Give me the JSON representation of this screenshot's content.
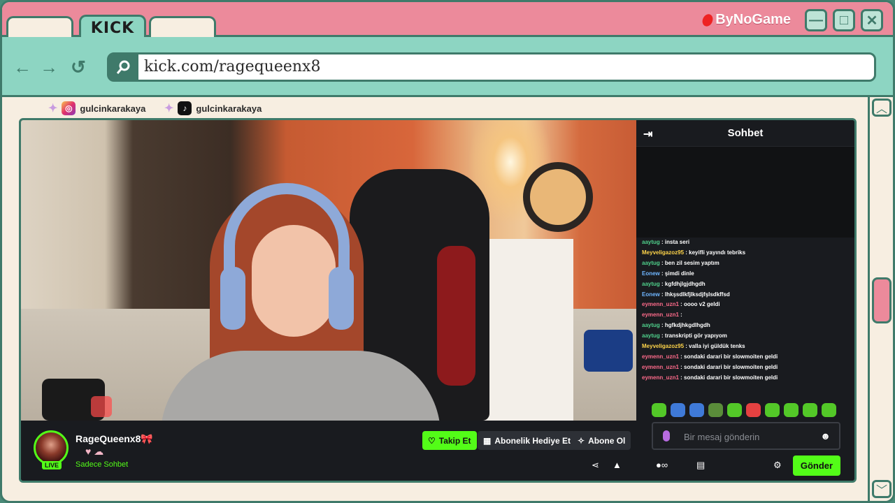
{
  "browser": {
    "tab_logo": "KICK",
    "brand": "ByNoGame",
    "url": "kick.com/ragequeenx8"
  },
  "socials": [
    {
      "platform": "instagram",
      "handle": "gulcinkarakaya"
    },
    {
      "platform": "tiktok",
      "handle": "gulcinkarakaya"
    }
  ],
  "stream": {
    "streamer": "RageQueenx8🎀",
    "live_badge": "LIVE",
    "category": "Sadece Sohbet",
    "follow_label": "Takip Et",
    "gift_label": "Abonelik Hediye Et",
    "subscribe_label": "Abone Ol"
  },
  "chat": {
    "title": "Sohbet",
    "placeholder": "Bir mesaj gönderin",
    "send_label": "Gönder",
    "messages": [
      {
        "user": "aaytug",
        "text": ": insta seri",
        "color": "#4fd08b"
      },
      {
        "user": "Meyveligazoz95",
        "text": ": keyifli yayındı tebriks",
        "color": "#ffd54a"
      },
      {
        "user": "aaytug",
        "text": ": ben zil sesim yaptım",
        "color": "#4fd08b"
      },
      {
        "user": "Eonew",
        "text": ": şimdi dinle",
        "color": "#6fb6ff"
      },
      {
        "user": "aaytug",
        "text": ": kgfdhjlgjdhgdh",
        "color": "#4fd08b"
      },
      {
        "user": "Eonew",
        "text": ": lhkşsdlkfjlksdjfşlsdkffsd",
        "color": "#6fb6ff"
      },
      {
        "user": "eymenn_uzn1",
        "text": ": oooo v2 geldi",
        "color": "#ff6b8b"
      },
      {
        "user": "eymenn_uzn1",
        "text": ":",
        "color": "#ff6b8b"
      },
      {
        "user": "aaytug",
        "text": ": hgfkdjhkgdlhgdh",
        "color": "#4fd08b"
      },
      {
        "user": "aaytug",
        "text": ": transkripti gör yapıyom",
        "color": "#4fd08b"
      },
      {
        "user": "Meyveligazoz95",
        "text": ": valla iyi güldük tenks",
        "color": "#ffd54a"
      },
      {
        "user": "eymenn_uzn1",
        "text": ": sondaki darari bir slowmoiten geldi",
        "color": "#ff6b8b"
      },
      {
        "user": "eymenn_uzn1",
        "text": ": sondaki darari bir slowmoiten geldi",
        "color": "#ff6b8b"
      },
      {
        "user": "eymenn_uzn1",
        "text": ": sondaki darari bir slowmoiten geldi",
        "color": "#ff6b8b"
      }
    ]
  }
}
